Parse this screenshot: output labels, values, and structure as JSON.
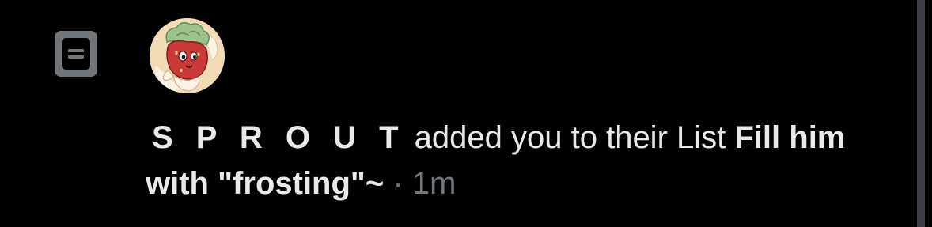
{
  "notification": {
    "type_icon": "list-icon",
    "avatar_icon": "strawberry-character-avatar",
    "user_name": "S P R O U T",
    "action_text": "added you to their List",
    "list_name": "Fill him with \"frosting\"~",
    "separator": "·",
    "timestamp": "1m"
  },
  "colors": {
    "background": "#000000",
    "primary_text": "#e7e9ea",
    "secondary_text": "#71767b",
    "icon_box": "#71767b",
    "scrollbar": "#3b3f44"
  }
}
